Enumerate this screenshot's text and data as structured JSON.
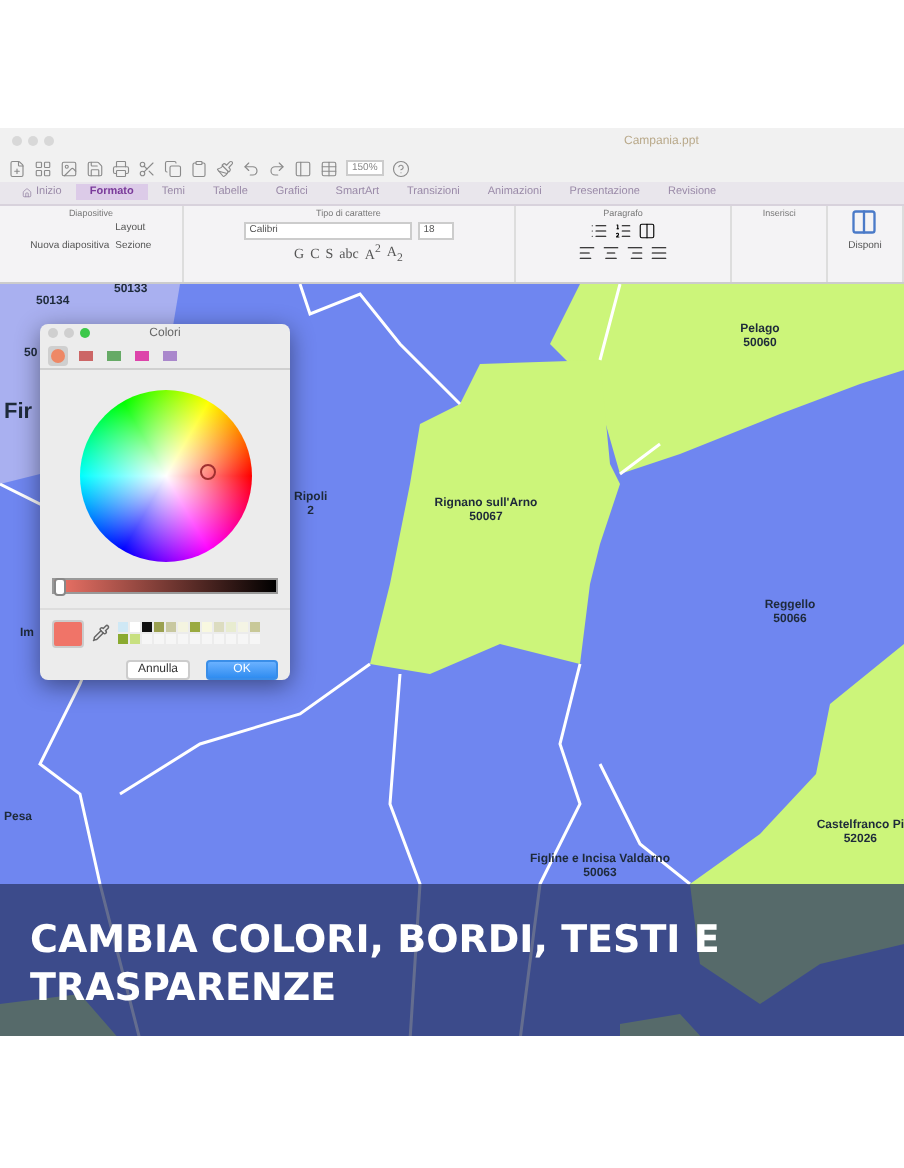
{
  "window": {
    "title": "Campania.ppt",
    "zoom": "150%"
  },
  "tabs": [
    {
      "label": "Inizio",
      "selected": false
    },
    {
      "label": "Formato",
      "selected": true
    },
    {
      "label": "Temi",
      "selected": false
    },
    {
      "label": "Tabelle",
      "selected": false
    },
    {
      "label": "Grafici",
      "selected": false
    },
    {
      "label": "SmartArt",
      "selected": false
    },
    {
      "label": "Transizioni",
      "selected": false
    },
    {
      "label": "Animazioni",
      "selected": false
    },
    {
      "label": "Presentazione",
      "selected": false
    },
    {
      "label": "Revisione",
      "selected": false
    }
  ],
  "slides_group": {
    "title": "Diapositive",
    "new_slide": "Nuova diapositiva",
    "layout": "Layout",
    "section": "Sezione"
  },
  "font_group": {
    "title": "Tipo di carattere",
    "font": "Calibri",
    "size": "18",
    "format_buttons": [
      "G",
      "C",
      "S",
      "abc",
      "A$^{2}$",
      "A$_{2}$"
    ]
  },
  "paragraph_group": {
    "title": "Paragrafo"
  },
  "insert_group": {
    "title": "Inserisci"
  },
  "arrange": {
    "label": "Disponi"
  },
  "map": {
    "labels": [
      {
        "text": "50133"
      },
      {
        "text": "50134"
      },
      {
        "text": "50"
      },
      {
        "text": "Fir",
        "kind": "city"
      },
      {
        "text": "Ripoli",
        "code": "2"
      },
      {
        "text": "Im"
      },
      {
        "text": "Pelago",
        "code": "50060"
      },
      {
        "text": "Rignano sull'Arno",
        "code": "50067"
      },
      {
        "text": "Reggello",
        "code": "50066"
      },
      {
        "text": "Pesa"
      },
      {
        "text": "Castelfranco Pi",
        "code": "52026"
      },
      {
        "text": "Figline e Incisa Valdarno",
        "code": "50063"
      }
    ]
  },
  "color_dialog": {
    "title": "Colori",
    "modes": [
      {
        "selected": true
      },
      {
        "selected": false
      },
      {
        "selected": false
      },
      {
        "selected": false
      },
      {
        "selected": false
      }
    ],
    "level": 0.02,
    "swatches": [
      {
        "color": "#cfe8f5"
      },
      {
        "color": "#ffffff"
      },
      {
        "color": "#111111"
      },
      {
        "color": "#9aa050"
      },
      {
        "color": "#c8c8a0"
      },
      {
        "color": "#f4f4e0"
      },
      {
        "color": "#9aaa40"
      },
      {
        "color": "#f8f8e0"
      },
      {
        "color": "#dcdcc0"
      },
      {
        "color": "#e8ecd0"
      },
      {
        "color": "#f4f4e4"
      },
      {
        "color": "#c8c898"
      },
      {
        "color": "#8aaa30"
      },
      {
        "color": "#c8e080"
      }
    ],
    "cancel": "Annulla",
    "ok": "OK"
  },
  "caption": {
    "lines": [
      "CAMBIA COLORI, BORDI, TESTI E",
      "TRASPARENZE"
    ]
  }
}
